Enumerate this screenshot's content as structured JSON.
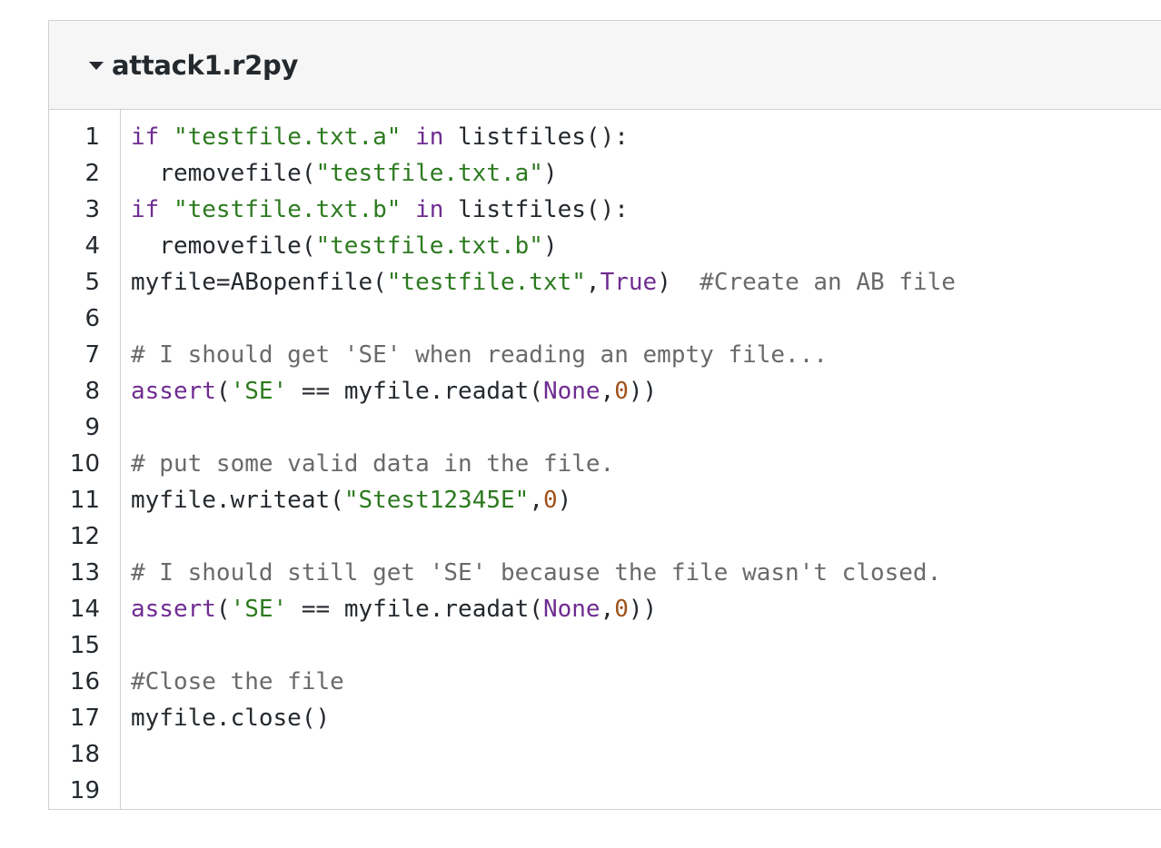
{
  "file": {
    "name": "attack1.r2py"
  },
  "icons": {
    "toggle": "caret-down-icon"
  },
  "colors": {
    "keyword": "#6f2c91",
    "string": "#2c7a1f",
    "number": "#a0521a",
    "comment": "#6a6a6a",
    "text": "#24292e"
  },
  "lines": [
    {
      "no": "1",
      "tokens": [
        [
          "kw",
          "if"
        ],
        [
          "plain",
          " "
        ],
        [
          "str",
          "\"testfile.txt.a\""
        ],
        [
          "plain",
          " "
        ],
        [
          "kw",
          "in"
        ],
        [
          "plain",
          " listfiles():"
        ]
      ]
    },
    {
      "no": "2",
      "tokens": [
        [
          "plain",
          "  removefile("
        ],
        [
          "str",
          "\"testfile.txt.a\""
        ],
        [
          "plain",
          ")"
        ]
      ]
    },
    {
      "no": "3",
      "tokens": [
        [
          "kw",
          "if"
        ],
        [
          "plain",
          " "
        ],
        [
          "str",
          "\"testfile.txt.b\""
        ],
        [
          "plain",
          " "
        ],
        [
          "kw",
          "in"
        ],
        [
          "plain",
          " listfiles():"
        ]
      ]
    },
    {
      "no": "4",
      "tokens": [
        [
          "plain",
          "  removefile("
        ],
        [
          "str",
          "\"testfile.txt.b\""
        ],
        [
          "plain",
          ")"
        ]
      ]
    },
    {
      "no": "5",
      "tokens": [
        [
          "plain",
          "myfile=ABopenfile("
        ],
        [
          "str",
          "\"testfile.txt\""
        ],
        [
          "plain",
          ","
        ],
        [
          "kw",
          "True"
        ],
        [
          "plain",
          ")  "
        ],
        [
          "com",
          "#Create an AB file"
        ]
      ]
    },
    {
      "no": "6",
      "tokens": []
    },
    {
      "no": "7",
      "tokens": [
        [
          "com",
          "# I should get 'SE' when reading an empty file..."
        ]
      ]
    },
    {
      "no": "8",
      "tokens": [
        [
          "kw",
          "assert"
        ],
        [
          "plain",
          "("
        ],
        [
          "str",
          "'SE'"
        ],
        [
          "plain",
          " == myfile.readat("
        ],
        [
          "kw",
          "None"
        ],
        [
          "plain",
          ","
        ],
        [
          "num",
          "0"
        ],
        [
          "plain",
          "))"
        ]
      ]
    },
    {
      "no": "9",
      "tokens": []
    },
    {
      "no": "10",
      "tokens": [
        [
          "com",
          "# put some valid data in the file."
        ]
      ]
    },
    {
      "no": "11",
      "tokens": [
        [
          "plain",
          "myfile.writeat("
        ],
        [
          "str",
          "\"Stest12345E\""
        ],
        [
          "plain",
          ","
        ],
        [
          "num",
          "0"
        ],
        [
          "plain",
          ")"
        ]
      ]
    },
    {
      "no": "12",
      "tokens": []
    },
    {
      "no": "13",
      "tokens": [
        [
          "com",
          "# I should still get 'SE' because the file wasn't closed."
        ]
      ]
    },
    {
      "no": "14",
      "tokens": [
        [
          "kw",
          "assert"
        ],
        [
          "plain",
          "("
        ],
        [
          "str",
          "'SE'"
        ],
        [
          "plain",
          " == myfile.readat("
        ],
        [
          "kw",
          "None"
        ],
        [
          "plain",
          ","
        ],
        [
          "num",
          "0"
        ],
        [
          "plain",
          "))"
        ]
      ]
    },
    {
      "no": "15",
      "tokens": []
    },
    {
      "no": "16",
      "tokens": [
        [
          "com",
          "#Close the file"
        ]
      ]
    },
    {
      "no": "17",
      "tokens": [
        [
          "plain",
          "myfile.close()"
        ]
      ]
    },
    {
      "no": "18",
      "tokens": []
    },
    {
      "no": "19",
      "tokens": []
    }
  ]
}
